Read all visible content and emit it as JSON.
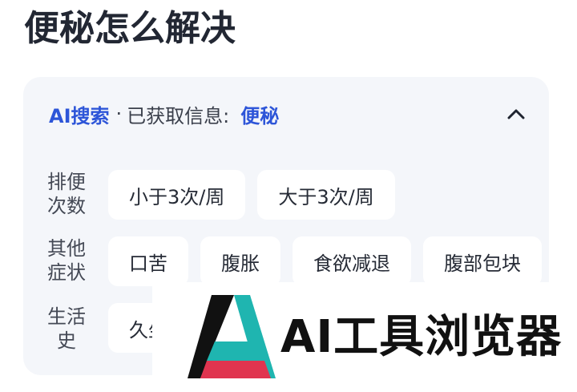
{
  "page": {
    "title": "便秘怎么解决"
  },
  "search_card": {
    "ai_label": "AI搜索",
    "separator": "·",
    "info_label": "已获取信息:",
    "keyword": "便秘",
    "collapse_icon": "chevron-up-icon"
  },
  "filters": {
    "frequency": {
      "label": "排便次数",
      "options": [
        "小于3次/周",
        "大于3次/周"
      ]
    },
    "symptoms": {
      "label": "其他症状",
      "options": [
        "口苦",
        "腹胀",
        "食欲减退",
        "腹部包块"
      ]
    },
    "history": {
      "label": "生活史",
      "options": [
        "久坐"
      ]
    }
  },
  "watermark": {
    "text": "AI工具浏览器"
  },
  "colors": {
    "accent": "#2d55d8",
    "card_bg": "#f4f6fa",
    "chip_bg": "#ffffff",
    "logo_teal": "#1fb5b0",
    "logo_red": "#e0344f"
  }
}
